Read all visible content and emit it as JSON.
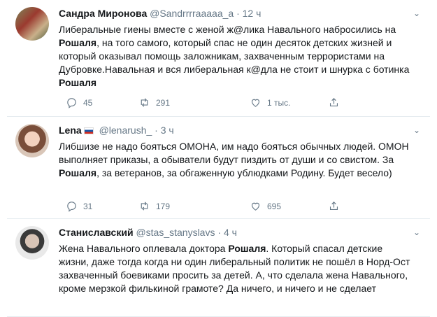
{
  "tweets": [
    {
      "name": "Сандра Миронова",
      "handle": "@Sandrrrraaaaa_a",
      "time": "12 ч",
      "text_parts": [
        "Либеральные гиены вместе с женой ж@лика Навального набросились на ",
        "Рошаля",
        ", на того самого, который спас не один десяток детских жизней и который оказывал помощь заложникам, захваченным террористами на Дубровке.Навальная и вся либеральная к@дла не стоит и  шнурка с ботинка ",
        "Рошаля",
        ""
      ],
      "reply_count": "45",
      "retweet_count": "291",
      "like_count": "1 тыс."
    },
    {
      "name": "Lena",
      "handle": "@lenarush_",
      "time": "3 ч",
      "text_parts": [
        "Либшизе не надо бояться ОМОНА, им надо бояться обычных людей. ОМОН выполняет приказы, а обыватели будут пиздить от души и со свистом. За ",
        "Рошаля",
        ", за ветеранов, за обгаженную ублюдками Родину. Будет весело)"
      ],
      "reply_count": "31",
      "retweet_count": "179",
      "like_count": "695"
    },
    {
      "name": "Станиславский",
      "handle": "@stas_stanyslavs",
      "time": "4 ч",
      "text_parts": [
        "Жена Навального оплевала доктора ",
        "Рошаля",
        ". Который спасал детские жизни, даже тогда когда ни один либеральный политик не пошёл в Норд-Ост захваченный боевиками просить за детей. А, что сделала жена Навального, кроме мерзкой филькиной грамоте? Да ничего, и ничего и не сделает"
      ]
    }
  ],
  "separator": "·",
  "icons": {
    "reply": "reply-icon",
    "retweet": "retweet-icon",
    "like": "like-icon",
    "share": "share-icon",
    "more": "chevron-down-icon",
    "flag": "russia-flag-icon"
  }
}
